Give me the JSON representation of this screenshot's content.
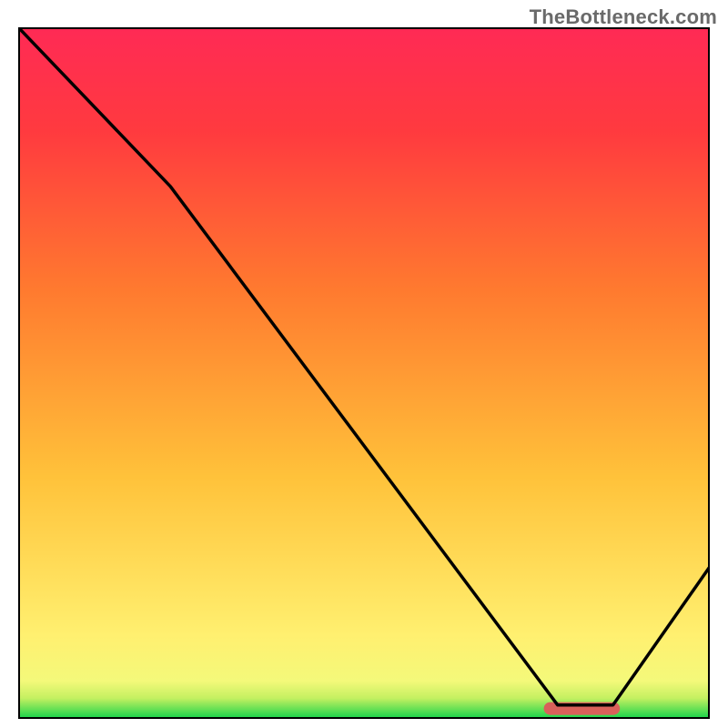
{
  "watermark": "TheBottleneck.com",
  "chart_data": {
    "type": "line",
    "title": "",
    "xlabel": "",
    "ylabel": "",
    "xlim": [
      0,
      100
    ],
    "ylim": [
      0,
      100
    ],
    "series": [
      {
        "name": "curve",
        "x": [
          0,
          22,
          78,
          86,
          100
        ],
        "y": [
          100,
          77,
          2,
          2,
          22
        ]
      }
    ],
    "marker": {
      "x_start": 76,
      "x_end": 87,
      "y": 1.5
    },
    "gradient_stops": [
      {
        "offset": 0.0,
        "color": "#11d24a"
      },
      {
        "offset": 0.03,
        "color": "#c4f061"
      },
      {
        "offset": 0.055,
        "color": "#f4f97a"
      },
      {
        "offset": 0.12,
        "color": "#fff070"
      },
      {
        "offset": 0.35,
        "color": "#ffc23a"
      },
      {
        "offset": 0.62,
        "color": "#ff7a2f"
      },
      {
        "offset": 0.85,
        "color": "#ff3a3f"
      },
      {
        "offset": 1.0,
        "color": "#ff2a55"
      }
    ],
    "axis_color": "#000000",
    "curve_color": "#000000",
    "marker_color": "#d9605a"
  }
}
